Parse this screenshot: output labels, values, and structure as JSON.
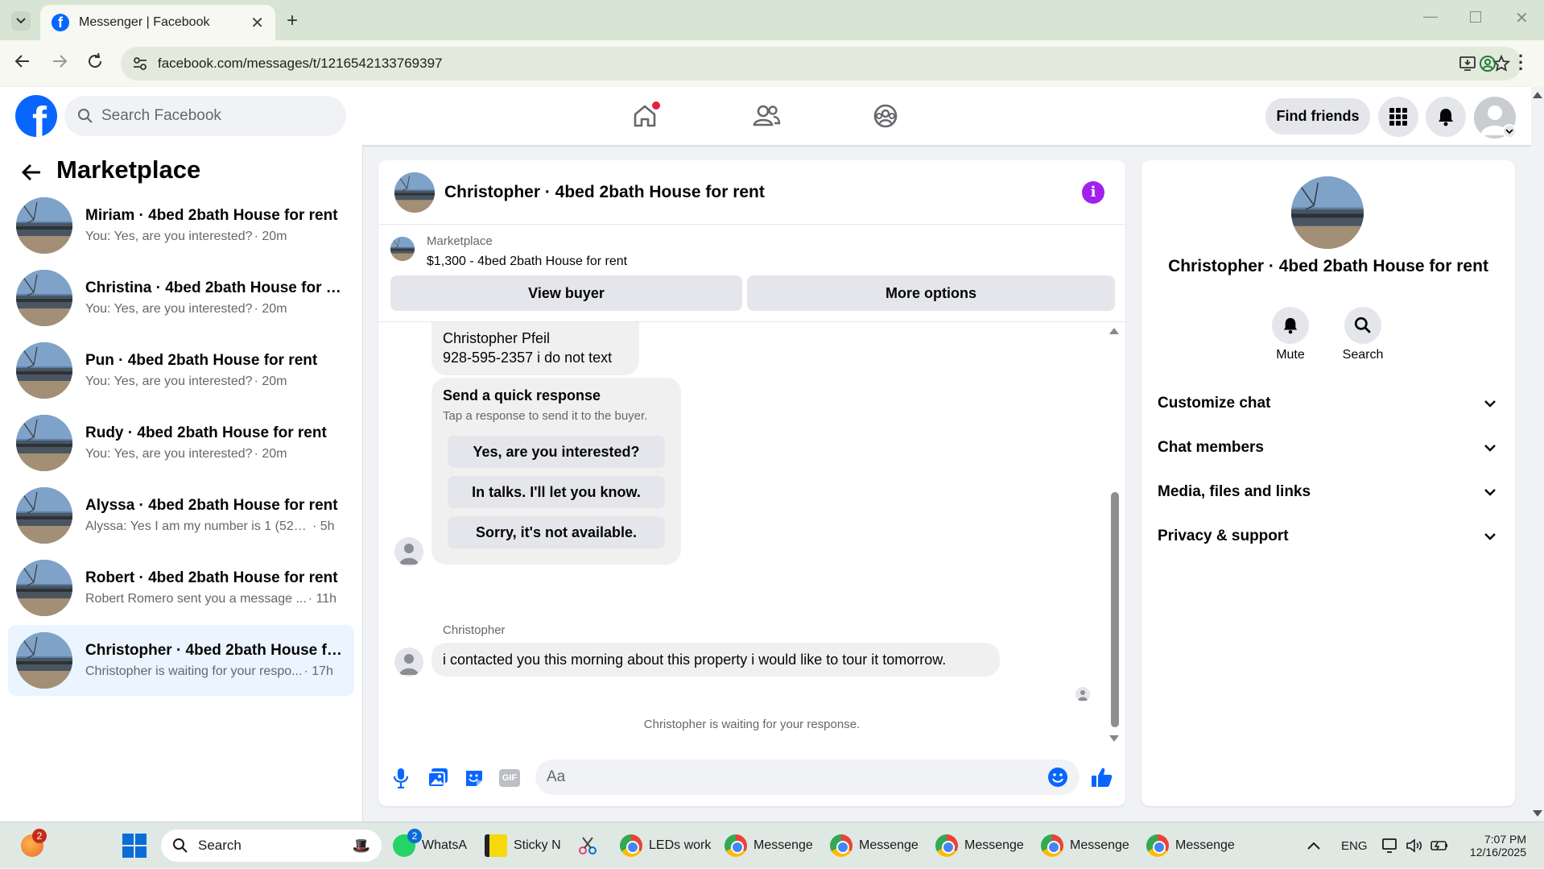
{
  "browser": {
    "tab_title": "Messenger | Facebook",
    "url": "facebook.com/messages/t/1216542133769397"
  },
  "fb_header": {
    "search_placeholder": "Search Facebook",
    "find_friends": "Find friends",
    "icons": [
      "home-icon",
      "friends-icon",
      "groups-icon",
      "menu-grid-icon",
      "bell-icon",
      "profile-avatar"
    ]
  },
  "left_pane": {
    "title": "Marketplace",
    "conversations": [
      {
        "name": "Miriam · 4bed 2bath House for rent",
        "preview": "You: Yes, are you interested?",
        "time": "· 20m"
      },
      {
        "name": "Christina · 4bed 2bath House for r...",
        "preview": "You: Yes, are you interested?",
        "time": "· 20m"
      },
      {
        "name": "Pun · 4bed 2bath House for rent",
        "preview": "You: Yes, are you interested?",
        "time": "· 20m"
      },
      {
        "name": "Rudy · 4bed 2bath House for rent",
        "preview": "You: Yes, are you interested?",
        "time": "· 20m"
      },
      {
        "name": "Alyssa · 4bed 2bath House for rent",
        "preview": "Alyssa: Yes I am my number is 1 (520) ...",
        "time": "· 5h"
      },
      {
        "name": "Robert · 4bed 2bath House for rent",
        "preview": "Robert Romero sent you a message ...",
        "time": "· 11h"
      },
      {
        "name": "Christopher · 4bed 2bath House fo...",
        "preview": "Christopher is waiting for your respo...",
        "time": "· 17h"
      }
    ]
  },
  "chat": {
    "title": "Christopher · 4bed 2bath House for rent",
    "listing_label": "Marketplace",
    "listing_title": "$1,300 - 4bed 2bath House for rent",
    "view_buyer": "View buyer",
    "more_options": "More options",
    "msg1_line1": "Christopher Pfeil",
    "msg1_line2": "928-595-2357  i do not text",
    "quick_title": "Send a quick response",
    "quick_sub": "Tap a response to send it to the buyer.",
    "quick_responses": [
      "Yes, are you interested?",
      "In talks. I'll let you know.",
      "Sorry, it's not available."
    ],
    "sender": "Christopher",
    "msg2": "i contacted you this morning about this property  i would like to tour it tomorrow.",
    "waiting": "Christopher is waiting for your response.",
    "composer_placeholder": "Aa"
  },
  "right_pane": {
    "name": "Christopher · 4bed 2bath House for rent",
    "mute": "Mute",
    "search": "Search",
    "sections": [
      "Customize chat",
      "Chat members",
      "Media, files and links",
      "Privacy & support"
    ]
  },
  "taskbar": {
    "search": "Search",
    "apps": [
      {
        "label": "WhatsA",
        "badge": "2"
      },
      {
        "label": "Sticky N"
      },
      {
        "label": "LEDs work"
      },
      {
        "label": "Messenge"
      },
      {
        "label": "Messenge"
      },
      {
        "label": "Messenge"
      },
      {
        "label": "Messenge"
      },
      {
        "label": "Messenge"
      }
    ],
    "weather_badge": "2",
    "lang": "ENG",
    "time": "7:07 PM",
    "date": "12/16/2025"
  }
}
